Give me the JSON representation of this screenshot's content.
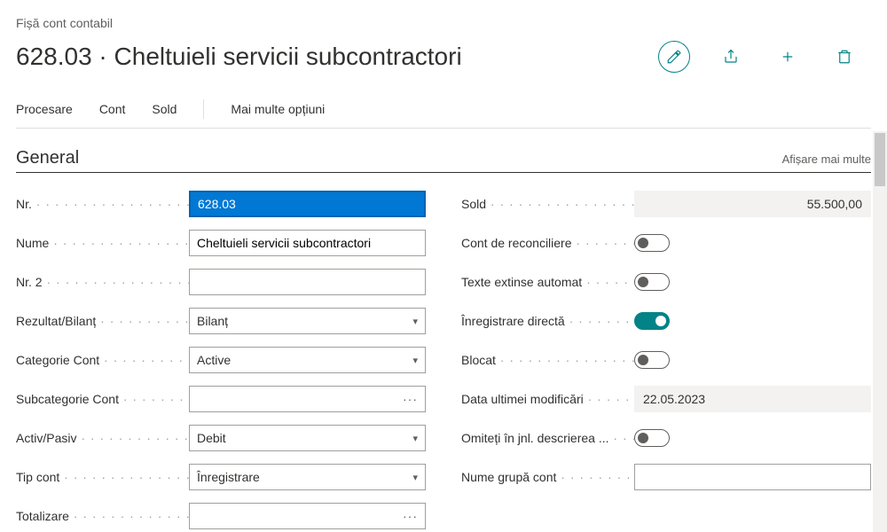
{
  "breadcrumb": "Fișă cont contabil",
  "title": "628.03 · Cheltuieli servicii subcontractori",
  "toolbar": {
    "procesare": "Procesare",
    "cont": "Cont",
    "sold": "Sold",
    "more": "Mai multe opțiuni"
  },
  "section": {
    "title": "General",
    "show_more": "Afișare mai multe"
  },
  "fields": {
    "nr_label": "Nr.",
    "nr_value": "628.03",
    "nume_label": "Nume",
    "nume_value": "Cheltuieli servicii subcontractori",
    "nr2_label": "Nr. 2",
    "nr2_value": "",
    "rezultat_label": "Rezultat/Bilanț",
    "rezultat_value": "Bilanț",
    "categorie_label": "Categorie Cont",
    "categorie_value": "Active",
    "subcategorie_label": "Subcategorie Cont",
    "subcategorie_value": "",
    "activpasiv_label": "Activ/Pasiv",
    "activpasiv_value": "Debit",
    "tipcont_label": "Tip cont",
    "tipcont_value": "Înregistrare",
    "totalizare_label": "Totalizare",
    "totalizare_value": "",
    "sold_label": "Sold",
    "sold_value": "55.500,00",
    "reconciliere_label": "Cont de reconciliere",
    "texte_label": "Texte extinse automat",
    "directa_label": "Înregistrare directă",
    "blocat_label": "Blocat",
    "data_label": "Data ultimei modificări",
    "data_value": "22.05.2023",
    "omiteti_label": "Omiteți în jnl. descrierea ...",
    "grupa_label": "Nume grupă cont",
    "grupa_value": ""
  }
}
